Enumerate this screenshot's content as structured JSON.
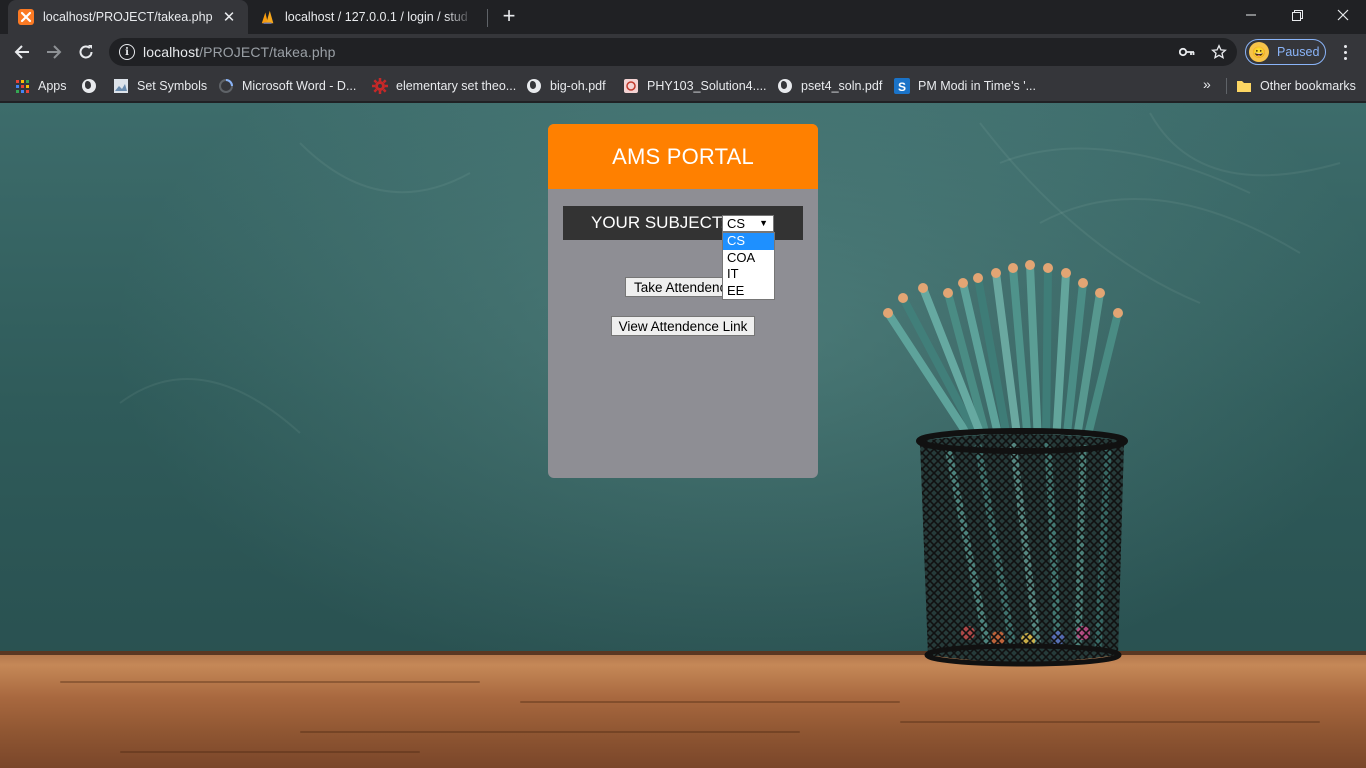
{
  "browser": {
    "tabs": [
      {
        "title": "localhost/PROJECT/takea.php",
        "active": true,
        "favicon": "xampp-icon"
      },
      {
        "title": "localhost / 127.0.0.1 / login / stud",
        "active": false,
        "favicon": "phpmyadmin-icon"
      }
    ],
    "url_host": "localhost",
    "url_path": "/PROJECT/takea.php",
    "profile_label": "Paused"
  },
  "bookmarks": [
    {
      "label": "Apps",
      "icon": "apps-grid-icon"
    },
    {
      "label": "",
      "icon": "globe-icon"
    },
    {
      "label": "Set Symbols",
      "icon": "page-thumbnail-icon"
    },
    {
      "label": "Microsoft Word - D...",
      "icon": "loading-circle-icon"
    },
    {
      "label": "elementary set theo...",
      "icon": "red-gear-icon"
    },
    {
      "label": "big-oh.pdf",
      "icon": "globe-icon"
    },
    {
      "label": "PHY103_Solution4....",
      "icon": "pdf-icon"
    },
    {
      "label": "pset4_soln.pdf",
      "icon": "globe-icon"
    },
    {
      "label": "PM Modi in Time's '...",
      "icon": "s-logo-icon"
    }
  ],
  "other_bookmarks": "Other bookmarks",
  "portal": {
    "title": "AMS PORTAL",
    "subject_label": "YOUR SUBJECT:",
    "selected_subject": "CS",
    "subject_options": [
      "CS",
      "COA",
      "IT",
      "EE"
    ],
    "take_button": "Take Attendence",
    "view_button": "View Attendence Link"
  },
  "colors": {
    "header_orange": "#ff8000",
    "panel_gray": "#8e8e94",
    "subject_bar": "#333333",
    "option_highlight": "#1e90ff"
  }
}
